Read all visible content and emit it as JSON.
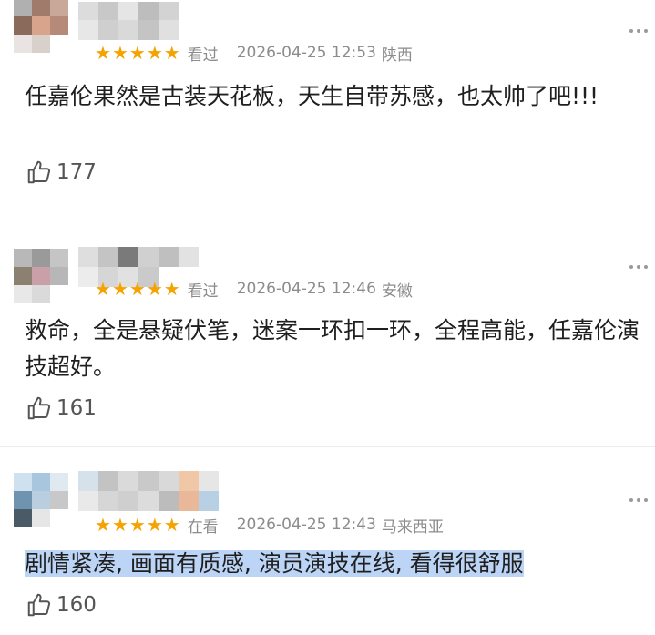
{
  "comments": [
    {
      "watch_status": "看过",
      "date": "2026-04-25 12:53",
      "region": "陕西",
      "text": "任嘉伦果然是古装天花板，天生自带苏感，也太帅了吧!!!",
      "likes": "177",
      "rating_stars": 5
    },
    {
      "watch_status": "看过",
      "date": "2026-04-25 12:46",
      "region": "安徽",
      "text": "救命，全是悬疑伏笔，迷案一环扣一环，全程高能，任嘉伦演技超好。",
      "likes": "161",
      "rating_stars": 5
    },
    {
      "watch_status": "在看",
      "date": "2026-04-25 12:43",
      "region": "马来西亚",
      "text": "剧情紧凑, 画面有质感, 演员演技在线, 看得很舒服",
      "likes": "160",
      "rating_stars": 5,
      "text_highlighted": true
    }
  ],
  "icons": {
    "star": "star-icon",
    "like": "thumbs-up-icon",
    "more": "more-dots-icon"
  },
  "colors": {
    "star": "#f5a300",
    "meta_text": "#8c8c8c",
    "highlight": "#bcd4f5"
  }
}
